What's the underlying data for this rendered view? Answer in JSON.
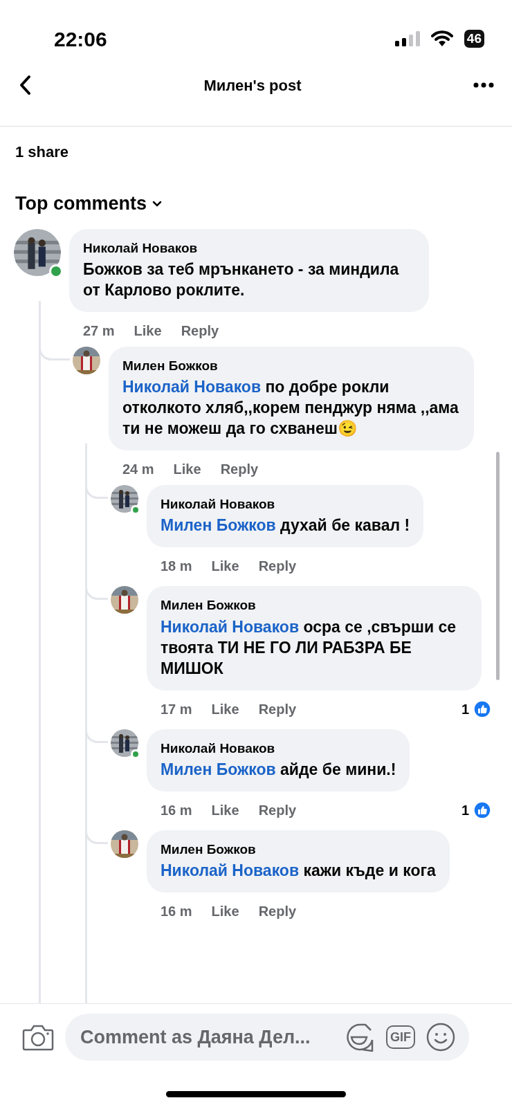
{
  "status_bar": {
    "time": "22:06",
    "battery": "46"
  },
  "header": {
    "title": "Милен's post"
  },
  "shares": "1 share",
  "sort": {
    "label": "Top comments"
  },
  "comments": [
    {
      "author": "Николай Новаков",
      "online": true,
      "text": "Божков за теб мрънкането - за миндила от Карлово роклите.",
      "time": "27 m",
      "like": "Like",
      "reply": "Reply",
      "children": [
        {
          "author": "Милен Божков",
          "online": false,
          "mention": "Николай Новаков",
          "text": "по добре рокли отколкото хляб,,корем пенджур няма ,,ама ти не можеш да го схванеш😉",
          "time": "24 m",
          "like": "Like",
          "reply": "Reply",
          "children": [
            {
              "author": "Николай Новаков",
              "online": true,
              "mention": "Милен Божков",
              "text": "духай бе кавал !",
              "time": "18 m",
              "like": "Like",
              "reply": "Reply"
            },
            {
              "author": "Милен Божков",
              "online": false,
              "mention": "Николай Новаков",
              "text": "осра се ,свърши се твоята ТИ НЕ ГО ЛИ РАБЗРА БЕ МИШОК",
              "time": "17 m",
              "like": "Like",
              "reply": "Reply",
              "reactions": "1"
            },
            {
              "author": "Николай Новаков",
              "online": true,
              "mention": "Милен Божков",
              "text": "айде бе мини.!",
              "time": "16 m",
              "like": "Like",
              "reply": "Reply",
              "reactions": "1"
            },
            {
              "author": "Милен Божков",
              "online": false,
              "mention": "Николай Новаков",
              "text": "кажи къде и кога",
              "time": "16 m",
              "like": "Like",
              "reply": "Reply"
            }
          ]
        }
      ]
    }
  ],
  "composer": {
    "placeholder": "Comment as Даяна Дел...",
    "gif": "GIF"
  }
}
